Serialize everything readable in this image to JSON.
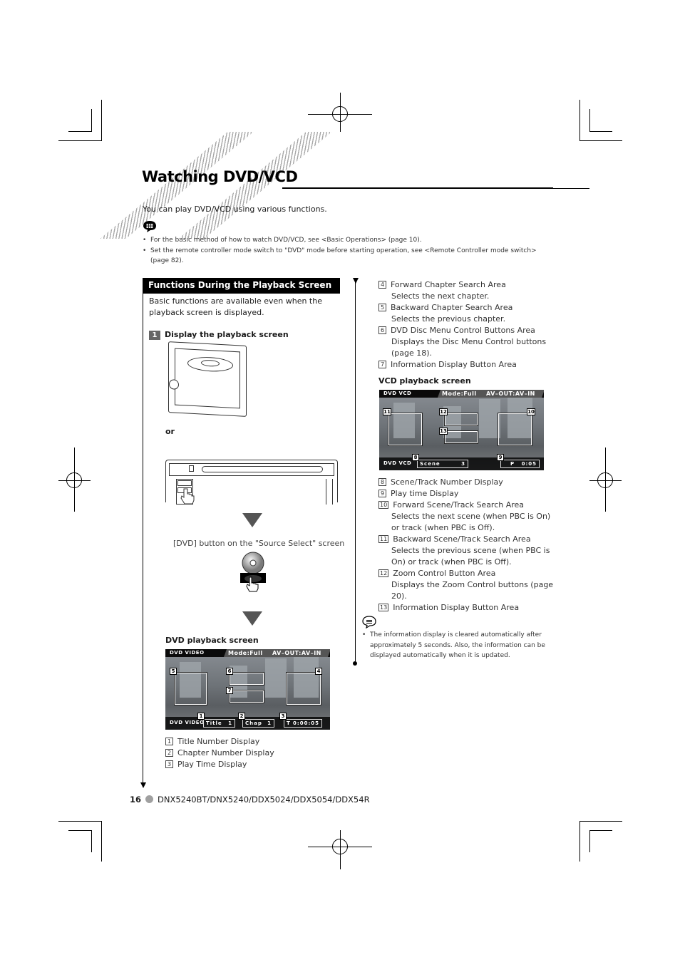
{
  "page": {
    "title": "Watching DVD/VCD",
    "intro": "You can play DVD/VCD using various functions.",
    "notes": [
      "For the basic method of how to watch DVD/VCD, see <Basic Operations> (page 10).",
      "Set the remote controller mode switch to \"DVD\" mode before starting operation, see <Remote Controller mode switch> (page 82)."
    ]
  },
  "section": {
    "heading": "Functions During the Playback Screen",
    "description": "Basic functions are available even when the playback screen is displayed.",
    "step_number": "1",
    "step_label": "Display the playback screen",
    "or_label": "or",
    "source_select_caption": "[DVD] button on the \"Source Select\" screen",
    "dvd_screen_label": "DVD playback screen",
    "vcd_screen_label": "VCD playback screen"
  },
  "dvd_screen": {
    "source": "DVD VIDEO",
    "mode": "Mode:Full",
    "av": "AV–OUT:AV–IN",
    "bottom_source": "DVD VIDEO",
    "title_field": "Title",
    "title_value": "1",
    "chap_field": "Chap",
    "chap_value": "1",
    "time_prefix": "T",
    "time": "0:00:05",
    "tags": [
      "1",
      "2",
      "3",
      "4",
      "5",
      "6",
      "7"
    ]
  },
  "vcd_screen": {
    "source": "DVD  VCD",
    "mode": "Mode:Full",
    "av": "AV–OUT:AV–IN",
    "bottom_source": "DVD  VCD",
    "scene_field": "Scene",
    "scene_value": "3",
    "time_prefix": "P",
    "time": "0:05",
    "tags": [
      "8",
      "9",
      "10",
      "11",
      "12",
      "13"
    ]
  },
  "dvd_items": [
    {
      "num": "1",
      "label": "Title Number Display"
    },
    {
      "num": "2",
      "label": "Chapter Number Display"
    },
    {
      "num": "3",
      "label": "Play Time Display"
    }
  ],
  "right_items": [
    {
      "num": "4",
      "label": "Forward Chapter Search Area",
      "desc": "Selects the next chapter."
    },
    {
      "num": "5",
      "label": "Backward Chapter Search Area",
      "desc": "Selects the previous chapter."
    },
    {
      "num": "6",
      "label": "DVD Disc Menu Control Buttons Area",
      "desc": "Displays the Disc Menu Control buttons (page 18)."
    },
    {
      "num": "7",
      "label": "Information Display Button Area",
      "desc": ""
    }
  ],
  "vcd_items": [
    {
      "num": "8",
      "label": "Scene/Track Number Display",
      "desc": ""
    },
    {
      "num": "9",
      "label": "Play time Display",
      "desc": ""
    },
    {
      "num": "10",
      "label": "Forward Scene/Track Search Area",
      "desc": "Selects the next scene (when PBC is On) or track (when PBC is Off)."
    },
    {
      "num": "11",
      "label": "Backward Scene/Track Search Area",
      "desc": "Selects the previous scene (when PBC is On) or track (when PBC is Off)."
    },
    {
      "num": "12",
      "label": "Zoom Control Button Area",
      "desc": "Displays the Zoom Control buttons (page 20)."
    },
    {
      "num": "13",
      "label": "Information Display Button Area",
      "desc": ""
    }
  ],
  "vcd_note": "The information display is cleared automatically after approximately 5 seconds. Also, the information can be displayed automatically when it is updated.",
  "footer": {
    "page_number": "16",
    "models": "DNX5240BT/DNX5240/DDX5024/DDX5054/DDX54R"
  },
  "icons": {
    "note": "speech-bubble-note-icon",
    "disc": "dvd-disc-icon",
    "hand": "pointing-hand-icon"
  }
}
